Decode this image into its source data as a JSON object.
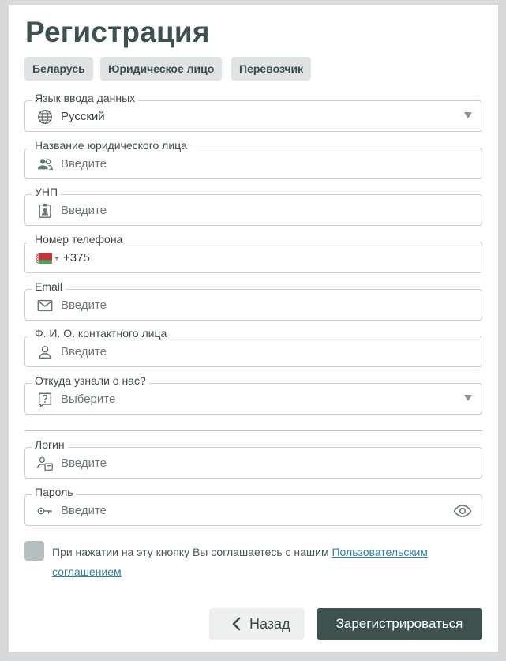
{
  "page": {
    "title": "Регистрация"
  },
  "chips": [
    {
      "label": "Беларусь"
    },
    {
      "label": "Юридическое лицо"
    },
    {
      "label": "Перевозчик"
    }
  ],
  "fields": {
    "language": {
      "label": "Язык ввода данных",
      "value": "Русский",
      "icon": "globe-icon"
    },
    "company_name": {
      "label": "Название юридического лица",
      "placeholder": "Введите",
      "icon": "people-icon"
    },
    "unp": {
      "label": "УНП",
      "placeholder": "Введите",
      "icon": "id-badge-icon"
    },
    "phone": {
      "label": "Номер телефона",
      "value": "+375",
      "icon": "belarus-flag-icon"
    },
    "email": {
      "label": "Email",
      "placeholder": "Введите",
      "icon": "envelope-icon"
    },
    "contact_name": {
      "label": "Ф. И. О. контактного лица",
      "placeholder": "Введите",
      "icon": "person-icon"
    },
    "source": {
      "label": "Откуда узнали о нас?",
      "placeholder": "Выберите",
      "icon": "question-icon"
    },
    "login": {
      "label": "Логин",
      "placeholder": "Введите",
      "icon": "user-card-icon"
    },
    "password": {
      "label": "Пароль",
      "placeholder": "Введите",
      "icon": "key-icon"
    }
  },
  "agreement": {
    "text": "При нажатии на эту кнопку Вы соглашаетесь с нашим ",
    "link": "Пользовательским соглашением"
  },
  "buttons": {
    "back": "Назад",
    "submit": "Зарегистрироваться"
  },
  "colors": {
    "accent": "#3d524f",
    "link": "#2f7fa6",
    "chip_bg": "#e0e3e3",
    "page_bg": "#d7d9da"
  }
}
